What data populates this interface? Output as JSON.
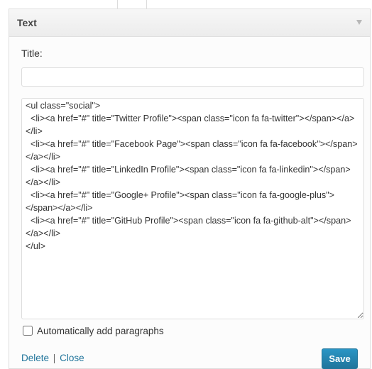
{
  "widget": {
    "title": "Text",
    "toggle_icon": "triangle-down-icon"
  },
  "form": {
    "title_label": "Title:",
    "title_value": "",
    "content": "<ul class=\"social\">\n  <li><a href=\"#\" title=\"Twitter Profile\"><span class=\"icon fa fa-twitter\"></span></a></li>\n  <li><a href=\"#\" title=\"Facebook Page\"><span class=\"icon fa fa-facebook\"></span></a></li>\n  <li><a href=\"#\" title=\"LinkedIn Profile\"><span class=\"icon fa fa-linkedin\"></span></a></li>\n  <li><a href=\"#\" title=\"Google+ Profile\"><span class=\"icon fa fa-google-plus\"></span></a></li>\n  <li><a href=\"#\" title=\"GitHub Profile\"><span class=\"icon fa fa-github-alt\"></span></a></li>\n</ul>",
    "auto_paragraphs_label": "Automatically add paragraphs",
    "auto_paragraphs_checked": false
  },
  "footer": {
    "delete_label": "Delete",
    "separator": "|",
    "close_label": "Close",
    "save_label": "Save"
  },
  "colors": {
    "link": "#21759b",
    "save_button": "#21759b"
  }
}
